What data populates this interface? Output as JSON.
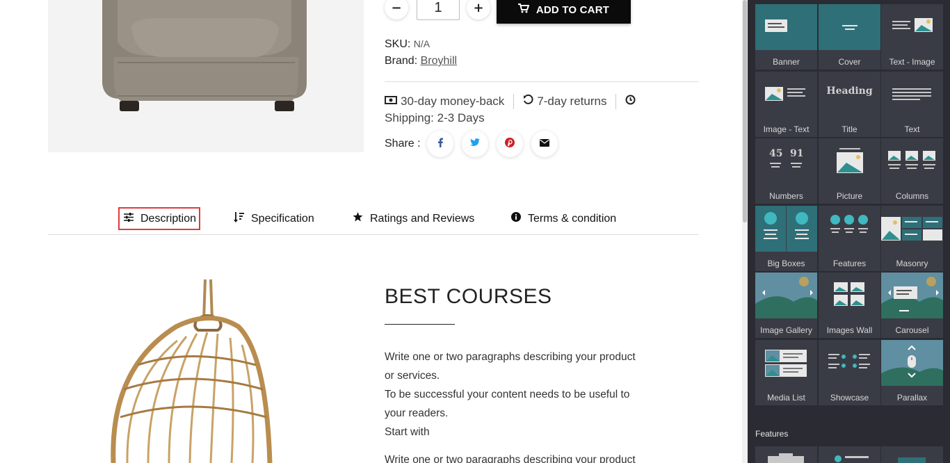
{
  "product": {
    "qty_minus": "−",
    "qty_value": "1",
    "qty_plus": "+",
    "add_to_cart": "ADD TO CART",
    "sku_label": "SKU:",
    "sku_value": "N/A",
    "brand_label": "Brand:",
    "brand_value": "Broyhill",
    "guarantee_money_back": "30-day money-back",
    "guarantee_returns": "7-day returns",
    "shipping": "Shipping: 2-3 Days",
    "share_label": "Share :"
  },
  "tabs": [
    {
      "label": "Description",
      "icon": "sliders-icon",
      "active": true
    },
    {
      "label": "Specification",
      "icon": "sort-icon",
      "active": false
    },
    {
      "label": "Ratings and Reviews",
      "icon": "star-icon",
      "active": false
    },
    {
      "label": "Terms & condition",
      "icon": "info-icon",
      "active": false
    }
  ],
  "content": {
    "title": "BEST COURSES",
    "para1_line1": "Write one or two paragraphs describing your product",
    "para1_line2": "or services.",
    "para1_line3": "To be successful your content needs to be useful to",
    "para1_line4": "your readers.",
    "para1_line5": "Start with",
    "para2_line1": "Write one or two paragraphs describing your product"
  },
  "panel": {
    "tiles": [
      {
        "label": "Banner"
      },
      {
        "label": "Cover"
      },
      {
        "label": "Text - Image"
      },
      {
        "label": "Image - Text"
      },
      {
        "label": "Title"
      },
      {
        "label": "Text"
      },
      {
        "label": "Numbers"
      },
      {
        "label": "Picture"
      },
      {
        "label": "Columns"
      },
      {
        "label": "Big Boxes"
      },
      {
        "label": "Features"
      },
      {
        "label": "Masonry"
      },
      {
        "label": "Image Gallery"
      },
      {
        "label": "Images Wall"
      },
      {
        "label": "Carousel"
      },
      {
        "label": "Media List"
      },
      {
        "label": "Showcase"
      },
      {
        "label": "Parallax"
      }
    ],
    "title_thumb_text": "Heading",
    "numbers_thumb_a": "45",
    "numbers_thumb_b": "91",
    "section_heading": "Features"
  },
  "colors": {
    "panel_bg": "#2b2c33",
    "tile_bg": "#3a3c45",
    "teal": "#2f6f78",
    "accent_red": "#e03a3a",
    "cart_bg": "#0b0b0b",
    "facebook": "#3b5998",
    "twitter": "#1da1f2",
    "pinterest": "#cb2027"
  }
}
